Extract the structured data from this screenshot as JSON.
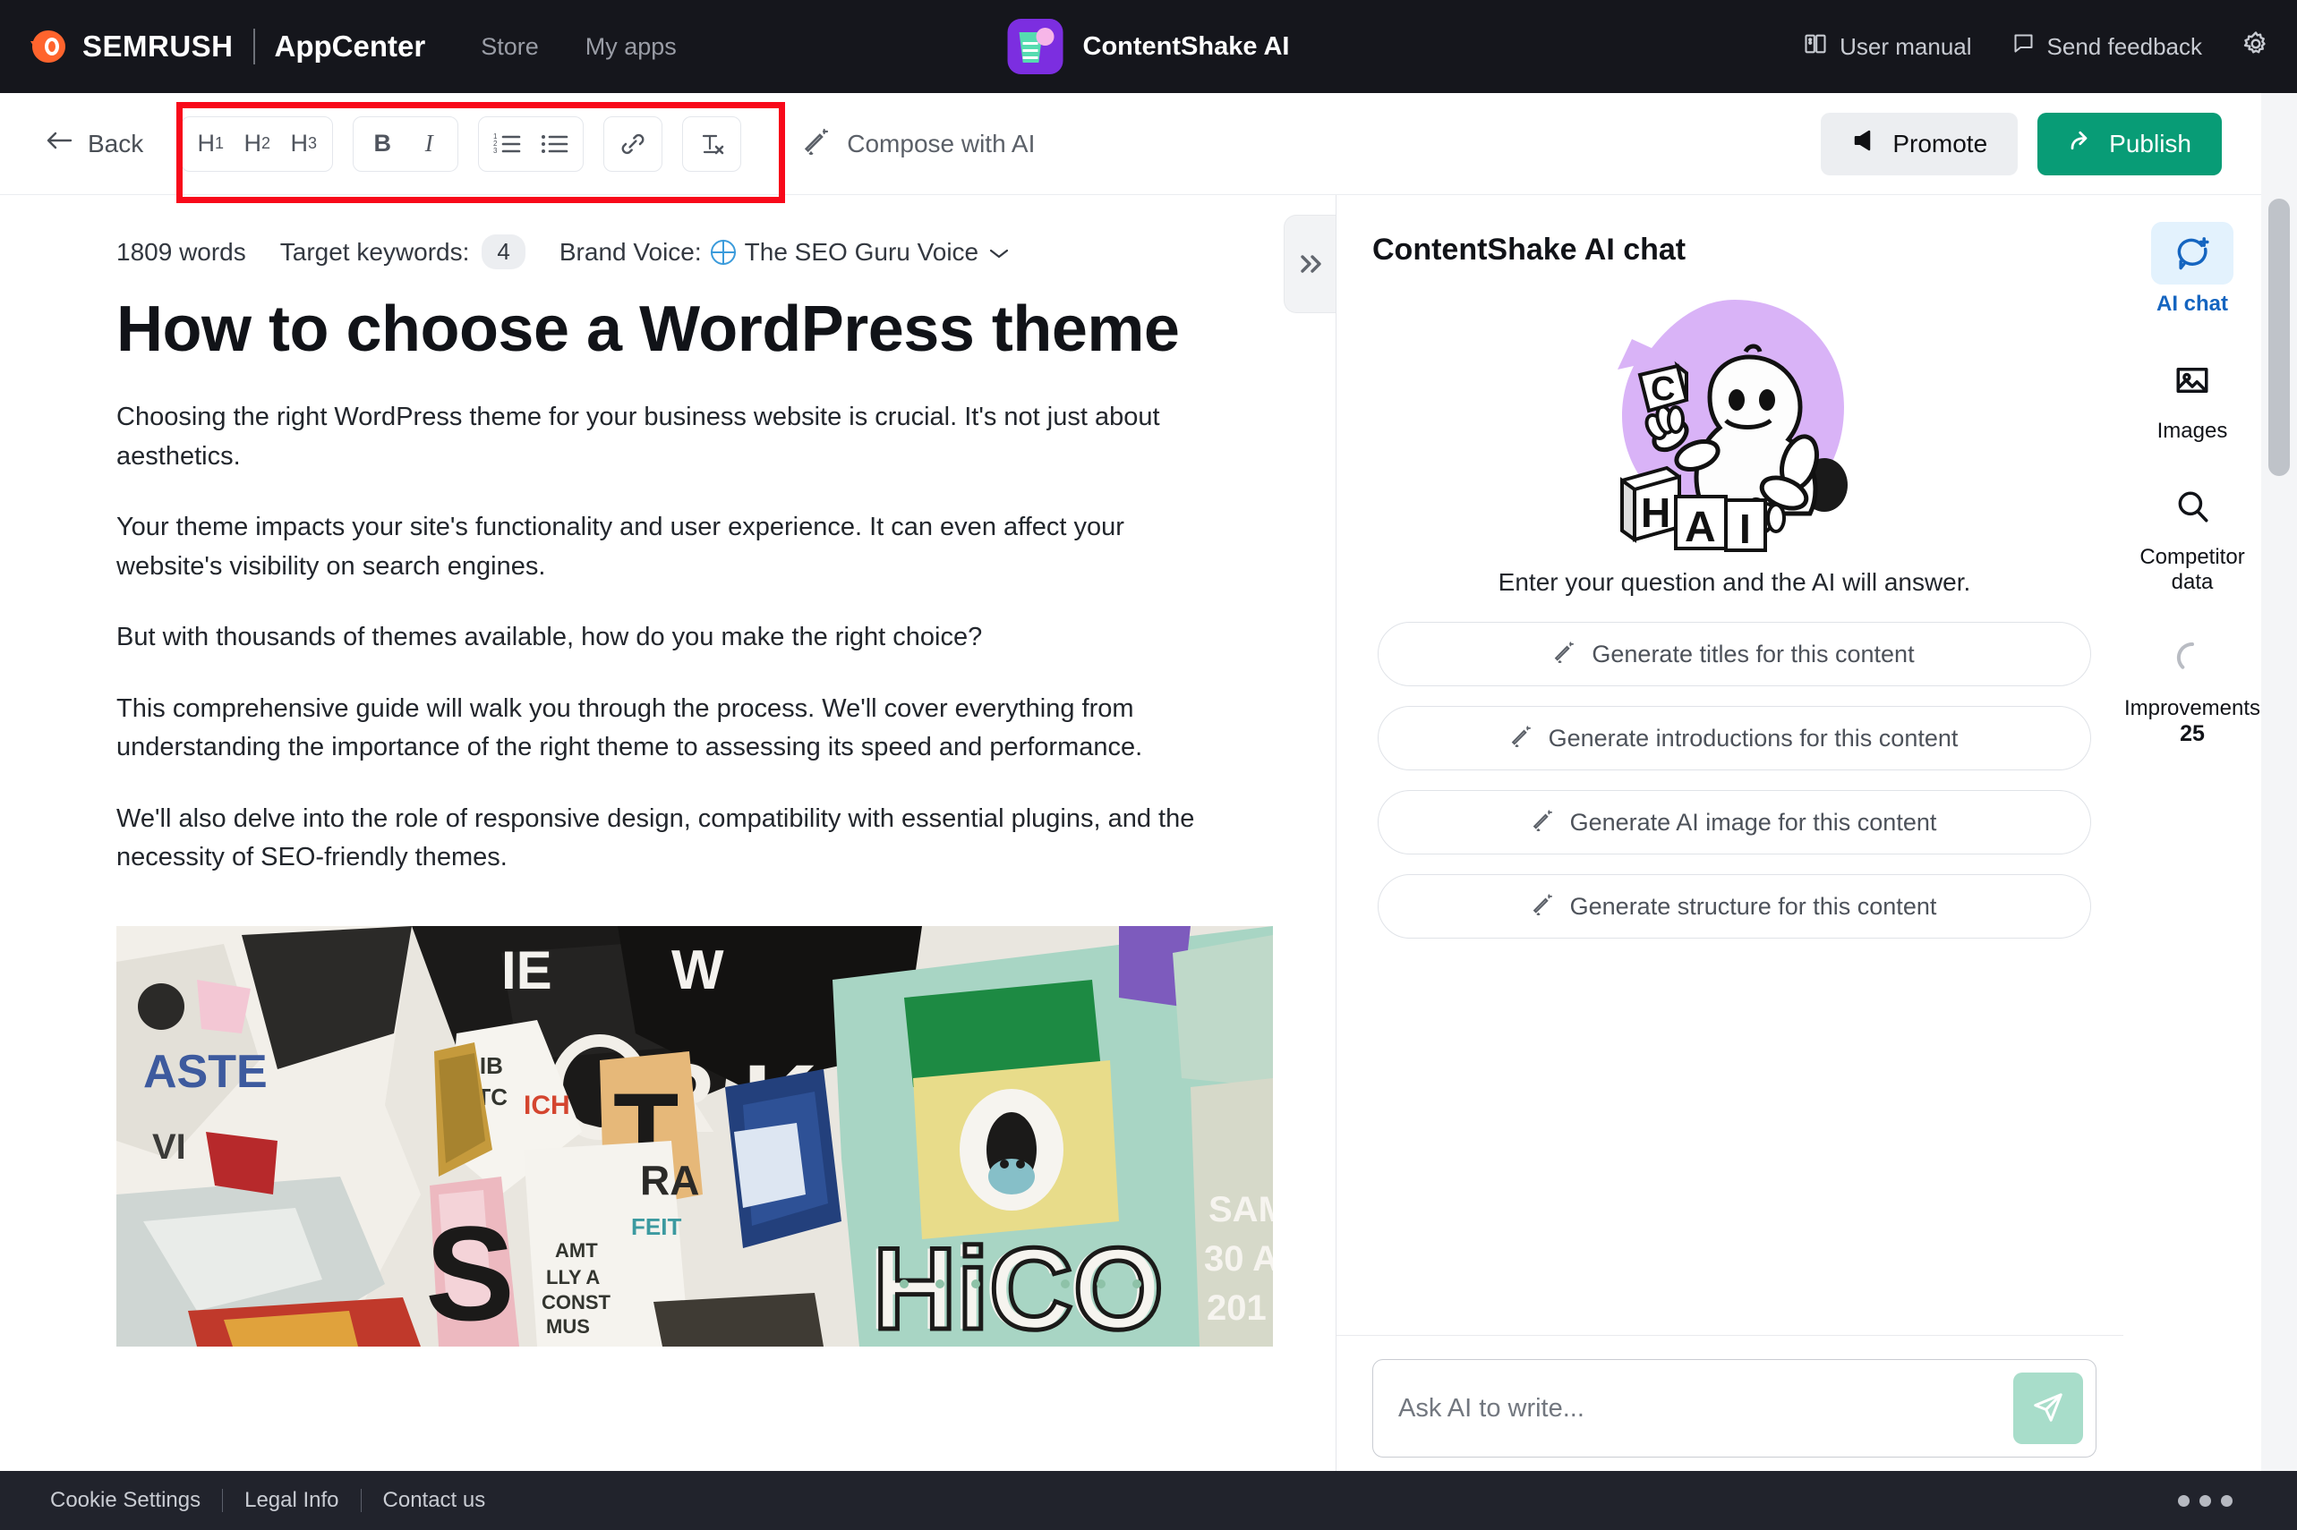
{
  "topnav": {
    "brand_semrush": "SEMRUSH",
    "brand_appcenter": "AppCenter",
    "links": [
      {
        "label": "Store",
        "icon": "store-link"
      },
      {
        "label": "My apps",
        "icon": "my-apps-link"
      }
    ],
    "app_title": "ContentShake AI",
    "app_icon": "contentshake-app-icon",
    "right_items": [
      {
        "label": "User manual",
        "icon": "book-icon"
      },
      {
        "label": "Send feedback",
        "icon": "speech-bubble-icon"
      }
    ],
    "settings_icon": "gear-icon"
  },
  "toolbar": {
    "back_label": "Back",
    "back_icon": "arrow-left-icon",
    "format_groups": [
      {
        "buttons": [
          {
            "label": "H",
            "sub": "1",
            "name": "heading-1-button"
          },
          {
            "label": "H",
            "sub": "2",
            "name": "heading-2-button"
          },
          {
            "label": "H",
            "sub": "3",
            "name": "heading-3-button"
          }
        ]
      },
      {
        "buttons": [
          {
            "label": "B",
            "sub": "",
            "name": "bold-button"
          },
          {
            "label": "I",
            "sub": "",
            "name": "italic-button"
          }
        ]
      }
    ],
    "list_ordered_icon": "ordered-list-icon",
    "list_bullet_icon": "bulleted-list-icon",
    "link_icon": "link-icon",
    "clear_format_icon": "clear-formatting-icon",
    "compose_label": "Compose with AI",
    "compose_icon": "magic-wand-icon",
    "promote_label": "Promote",
    "promote_icon": "megaphone-icon",
    "publish_label": "Publish",
    "publish_icon": "share-arrow-icon",
    "highlight_color": "#f8091a"
  },
  "document": {
    "word_count": "1809 words",
    "target_keywords_label": "Target keywords:",
    "target_keywords_count": "4",
    "brand_voice_label": "Brand Voice:",
    "brand_voice_value": "The SEO Guru Voice",
    "brand_voice_icon": "globe-icon",
    "brand_voice_chevron": "chevron-down-icon",
    "title": "How to choose a WordPress theme",
    "paragraphs": [
      "Choosing the right WordPress theme for your business website is crucial. It's not just about aesthetics.",
      "Your theme impacts your site's functionality and user experience. It can even affect your website's visibility on search engines.",
      "But with thousands of themes available, how do you make the right choice?",
      "This comprehensive guide will walk you through the process. We'll cover everything from understanding the importance of the right theme to assessing its speed and performance.",
      "We'll also delve into the role of responsive design, compatibility with essential plugins, and the necessity of SEO-friendly themes."
    ],
    "image_alt": "Torn layered street posters collage wall",
    "collapse_icon": "chevron-double-right-icon"
  },
  "chat": {
    "title": "ContentShake AI chat",
    "mascot_icon": "robot-with-blocks-illustration",
    "mascot_blocks": [
      "C",
      "H",
      "A",
      "I"
    ],
    "hint": "Enter your question and the AI will answer.",
    "suggestions": [
      {
        "label": "Generate titles for this content",
        "icon": "magic-wand-icon"
      },
      {
        "label": "Generate introductions for this content",
        "icon": "magic-wand-icon"
      },
      {
        "label": "Generate AI image for this content",
        "icon": "magic-wand-icon"
      },
      {
        "label": "Generate structure for this content",
        "icon": "magic-wand-icon"
      }
    ],
    "input_placeholder": "Ask AI to write...",
    "input_value": "",
    "send_icon": "send-paper-plane-icon"
  },
  "rail": {
    "items": [
      {
        "label": "AI chat",
        "icon": "ai-chat-icon",
        "active": true,
        "count": ""
      },
      {
        "label": "Images",
        "icon": "image-icon",
        "active": false,
        "count": ""
      },
      {
        "label": "Competitor data",
        "icon": "magnifier-icon",
        "active": false,
        "count": ""
      },
      {
        "label": "Improvements",
        "icon": "loading-spinner-icon",
        "active": false,
        "count": "25"
      }
    ],
    "active_color": "#1565c0"
  },
  "footer": {
    "links": [
      "Cookie Settings",
      "Legal Info",
      "Contact us"
    ],
    "more_icon": "more-dots-icon"
  }
}
